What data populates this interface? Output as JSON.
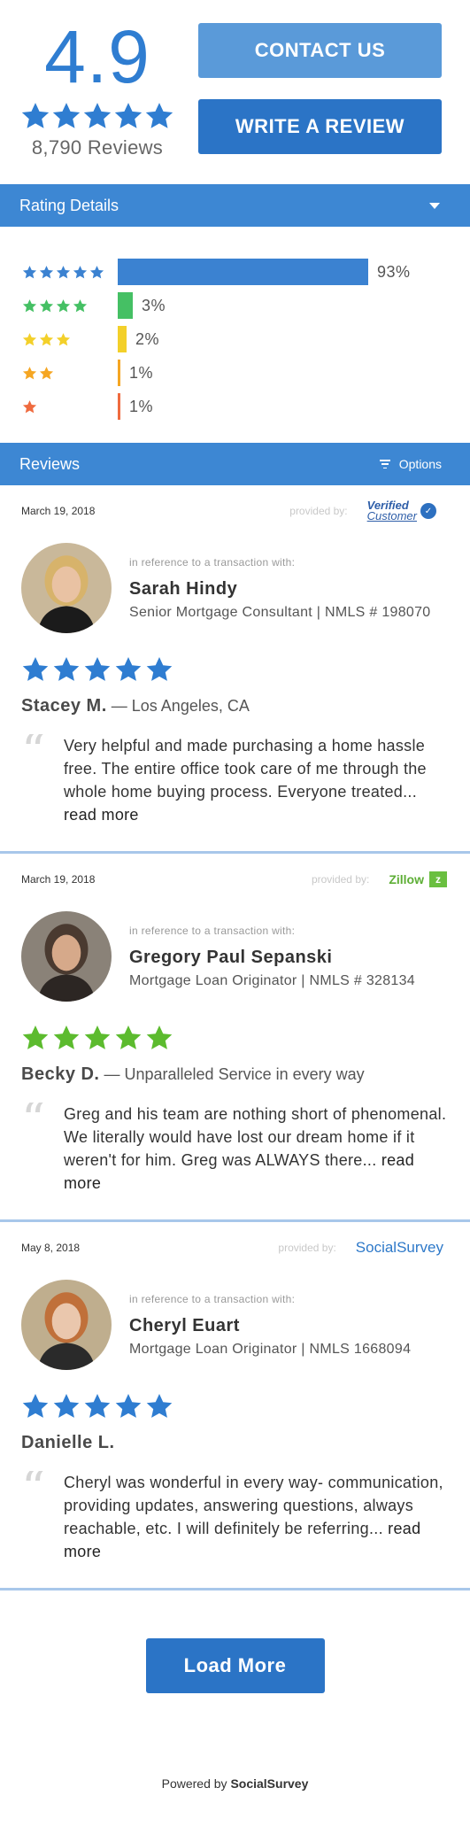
{
  "summary": {
    "score": "4.9",
    "stars": 5,
    "review_count": "8,790 Reviews",
    "contact_label": "CONTACT US",
    "write_label": "WRITE A REVIEW"
  },
  "rating_details": {
    "title": "Rating Details",
    "rows": [
      {
        "stars": 5,
        "percent": "93%",
        "value": 93,
        "color": "#3b82d1"
      },
      {
        "stars": 4,
        "percent": "3%",
        "value": 3,
        "color": "#45c064"
      },
      {
        "stars": 3,
        "percent": "2%",
        "value": 2,
        "color": "#f3d02a"
      },
      {
        "stars": 2,
        "percent": "1%",
        "value": 1,
        "color": "#f5a623"
      },
      {
        "stars": 1,
        "percent": "1%",
        "value": 1,
        "color": "#ef6b3f"
      }
    ]
  },
  "reviews_header": {
    "title": "Reviews",
    "options_label": "Options"
  },
  "colors": {
    "blue_star": "#2f7dd1",
    "green_star": "#5cbb2e",
    "accent": "#3d87d3",
    "button": "#2b74c6"
  },
  "reviews": [
    {
      "date": "March 19, 2018",
      "provided_by": "provided by:",
      "provider": {
        "type": "verified",
        "line1": "Verified",
        "line2": "Customer"
      },
      "ref": "in reference to a transaction with:",
      "agent_name": "Sarah Hindy",
      "agent_title": "Senior Mortgage Consultant | NMLS # 198070",
      "star_color": "#2f7dd1",
      "reviewer": "Stacey M.",
      "reviewer_note": " — Los Angeles, CA",
      "text": "Very helpful and made purchasing a home hassle free. The entire office took care of me through the whole home buying process. Everyone treated...",
      "read_more": " read more"
    },
    {
      "date": "March 19, 2018",
      "provided_by": "provided by:",
      "provider": {
        "type": "zillow",
        "name": "Zillow"
      },
      "ref": "in reference to a transaction with:",
      "agent_name": "Gregory Paul Sepanski",
      "agent_title": "Mortgage Loan Originator | NMLS # 328134",
      "star_color": "#5cbb2e",
      "reviewer": "Becky D.",
      "reviewer_note": " — Unparalleled Service in every way",
      "text": "Greg and his team are nothing short of phenomenal. We literally would have lost our dream home if it weren't for him. Greg was ALWAYS there...",
      "read_more": " read more"
    },
    {
      "date": "May 8, 2018",
      "provided_by": "provided by:",
      "provider": {
        "type": "socialsurvey",
        "name": "SocialSurvey"
      },
      "ref": "in reference to a transaction with:",
      "agent_name": "Cheryl Euart",
      "agent_title": "Mortgage Loan Originator | NMLS 1668094",
      "star_color": "#2f7dd1",
      "reviewer": "Danielle L.",
      "reviewer_note": "",
      "text": "Cheryl was wonderful in every way- communication, providing updates, answering questions, always reachable, etc. I will definitely be referring...",
      "read_more": " read more"
    }
  ],
  "load_more_label": "Load More",
  "footer": {
    "powered_prefix": "Powered by ",
    "powered_brand": "SocialSurvey"
  }
}
